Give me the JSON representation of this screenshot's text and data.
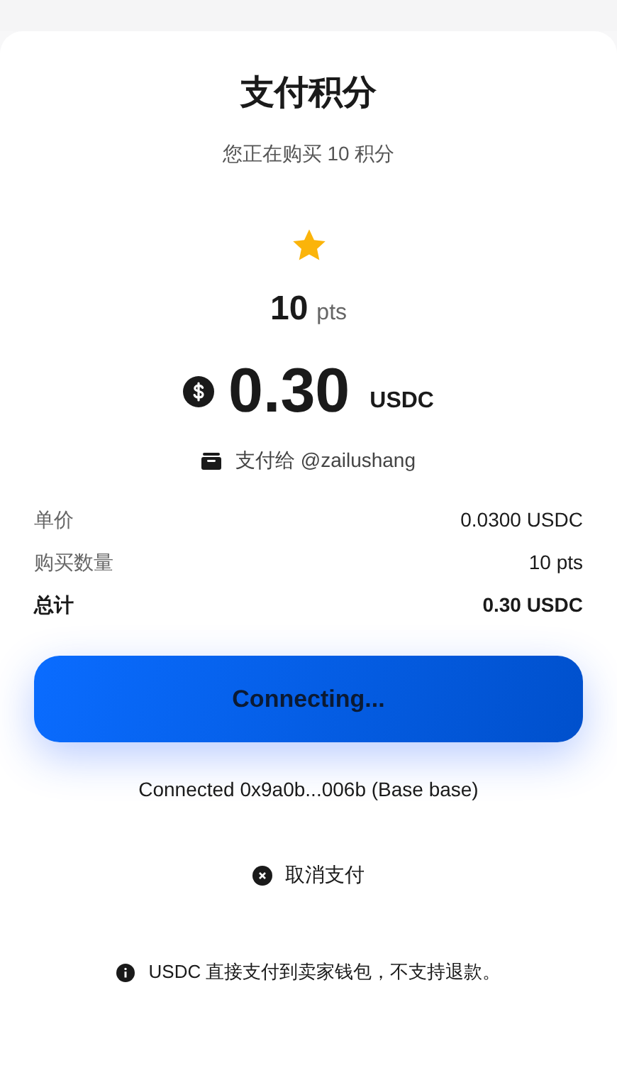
{
  "title": "支付积分",
  "subtitle": "您正在购买 10 积分",
  "points": {
    "value": "10",
    "unit": "pts"
  },
  "amount": {
    "value": "0.30",
    "currency": "USDC"
  },
  "pay_to": "支付给 @zailushang",
  "summary": [
    {
      "label": "单价",
      "value": "0.0300 USDC",
      "kind": "normal"
    },
    {
      "label": "购买数量",
      "value": "10 pts",
      "kind": "normal"
    },
    {
      "label": "总计",
      "value": "0.30 USDC",
      "kind": "total"
    }
  ],
  "pay_button": {
    "label": "Connecting...",
    "disabled": true
  },
  "wallet_status": "Connected 0x9a0b...006b (Base base)",
  "cancel_button": "取消支付",
  "note": "USDC 直接支付到卖家钱包，不支持退款。"
}
